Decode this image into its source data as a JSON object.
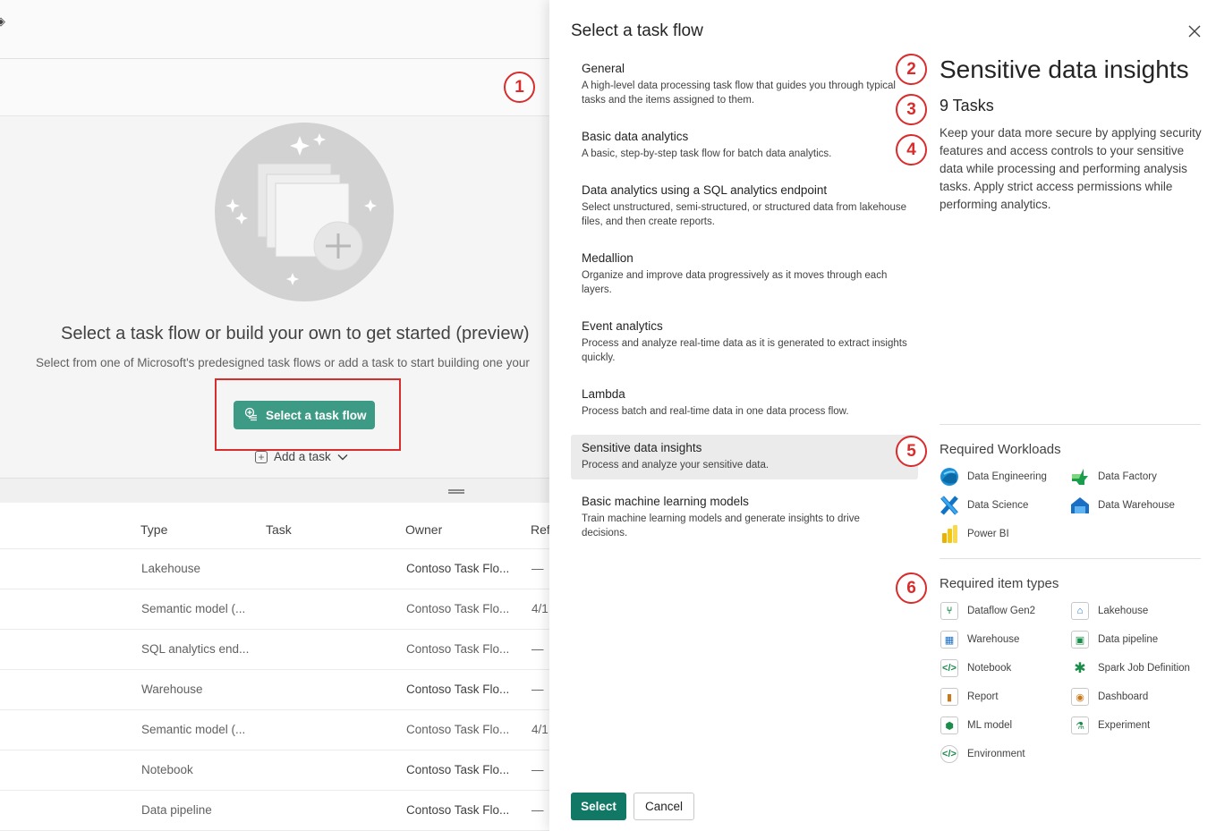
{
  "background": {
    "hero_title": "Select a task flow or build your own to get started (preview)",
    "hero_subtitle": "Select from one of Microsoft's predesigned task flows or add a task to start building one your",
    "select_task_flow_button": "Select a task flow",
    "add_task_label": "Add a task",
    "table": {
      "columns": [
        "Type",
        "Task",
        "Owner",
        "Ref"
      ],
      "rows": [
        {
          "type": "Lakehouse",
          "owner": "Contoso Task Flo...",
          "ref": "—"
        },
        {
          "type": "Semantic model (...",
          "owner": "Contoso Task Flo...",
          "ref": "4/1"
        },
        {
          "type": "SQL analytics end...",
          "owner": "Contoso Task Flo...",
          "ref": "—"
        },
        {
          "type": "Warehouse",
          "owner": "Contoso Task Flo...",
          "ref": "—"
        },
        {
          "type": "Semantic model (...",
          "owner": "Contoso Task Flo...",
          "ref": "4/1"
        },
        {
          "type": "Notebook",
          "owner": "Contoso Task Flo...",
          "ref": "—"
        },
        {
          "type": "Data pipeline",
          "owner": "Contoso Task Flo...",
          "ref": "—"
        }
      ]
    }
  },
  "callouts": [
    "1",
    "2",
    "3",
    "4",
    "5",
    "6"
  ],
  "dialog": {
    "title": "Select a task flow",
    "close_icon": "close-icon",
    "task_flows": [
      {
        "name": "General",
        "description": "A high-level data processing task flow that guides you through typical tasks and the items assigned to them."
      },
      {
        "name": "Basic data analytics",
        "description": "A basic, step-by-step task flow for batch data analytics."
      },
      {
        "name": "Data analytics using a SQL analytics endpoint",
        "description": "Select unstructured, semi-structured, or structured data from lakehouse files, and then create reports."
      },
      {
        "name": "Medallion",
        "description": "Organize and improve data progressively as it moves through each layers."
      },
      {
        "name": "Event analytics",
        "description": "Process and analyze real-time data as it is generated to extract insights quickly."
      },
      {
        "name": "Lambda",
        "description": "Process batch and real-time data in one data process flow."
      },
      {
        "name": "Sensitive data insights",
        "description": "Process and analyze your sensitive data."
      },
      {
        "name": "Basic machine learning models",
        "description": "Train machine learning models and generate insights to drive decisions."
      }
    ],
    "selected_index": 6,
    "detail": {
      "title": "Sensitive data insights",
      "task_count": "9 Tasks",
      "description": "Keep your data more secure by applying security features and access controls to your sensitive data while processing and performing analysis tasks. Apply strict access permissions while performing analytics."
    },
    "required_workloads_title": "Required Workloads",
    "required_workloads": [
      {
        "label": "Data Engineering",
        "icon": "data-engineering-icon"
      },
      {
        "label": "Data Factory",
        "icon": "data-factory-icon"
      },
      {
        "label": "Data Science",
        "icon": "data-science-icon"
      },
      {
        "label": "Data Warehouse",
        "icon": "data-warehouse-icon"
      },
      {
        "label": "Power BI",
        "icon": "power-bi-icon"
      }
    ],
    "required_items_title": "Required item types",
    "required_items": [
      {
        "label": "Dataflow Gen2",
        "icon": "dataflow-gen2-icon"
      },
      {
        "label": "Lakehouse",
        "icon": "lakehouse-icon"
      },
      {
        "label": "Warehouse",
        "icon": "warehouse-icon"
      },
      {
        "label": "Data pipeline",
        "icon": "data-pipeline-icon"
      },
      {
        "label": "Notebook",
        "icon": "notebook-icon"
      },
      {
        "label": "Spark Job Definition",
        "icon": "spark-job-definition-icon"
      },
      {
        "label": "Report",
        "icon": "report-icon"
      },
      {
        "label": "Dashboard",
        "icon": "dashboard-icon"
      },
      {
        "label": "ML model",
        "icon": "ml-model-icon"
      },
      {
        "label": "Experiment",
        "icon": "experiment-icon"
      },
      {
        "label": "Environment",
        "icon": "environment-icon"
      }
    ],
    "select_button": "Select",
    "cancel_button": "Cancel"
  }
}
